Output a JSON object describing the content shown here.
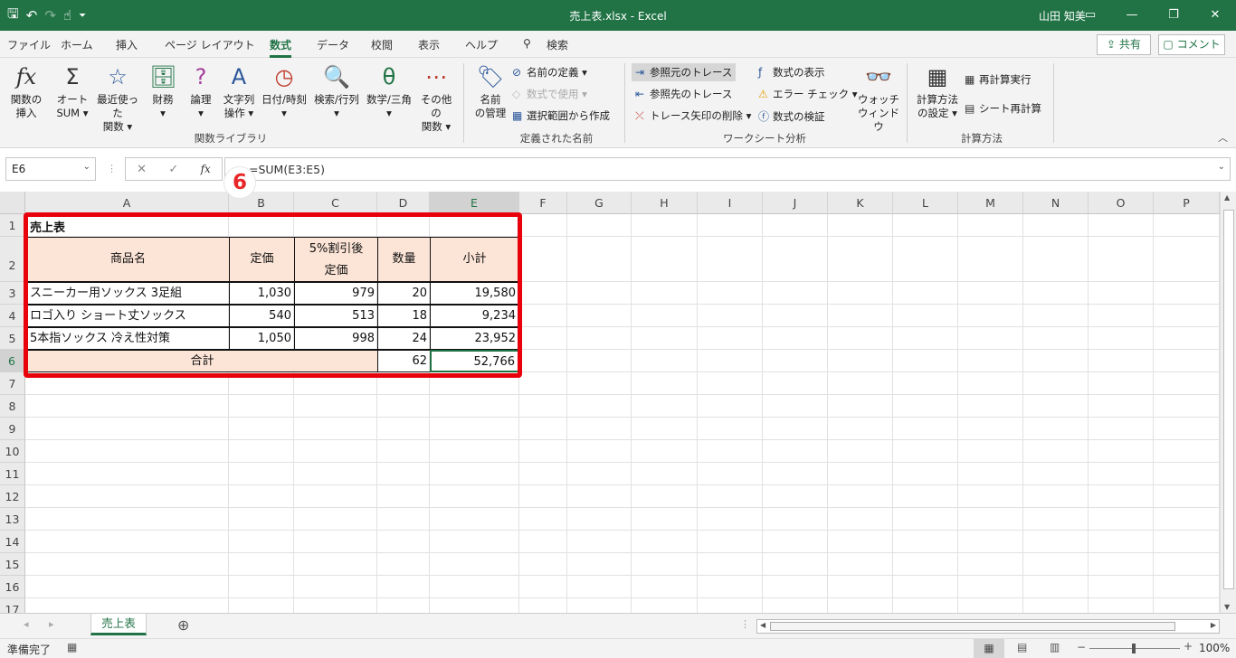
{
  "titlebar": {
    "title": "売上表.xlsx  -  Excel",
    "user": "山田 知美",
    "save_icon": "🖫",
    "undo_icon": "↶",
    "redo_icon": "↷",
    "touch_icon": "☝",
    "qat_menu_icon": "⏷",
    "ribbon_display_icon": "▭",
    "minimize_icon": "—",
    "restore_icon": "❐",
    "close_icon": "✕"
  },
  "tabs": [
    "ファイル",
    "ホーム",
    "挿入",
    "ページ レイアウト",
    "数式",
    "データ",
    "校閲",
    "表示",
    "ヘルプ",
    "検索"
  ],
  "search_icon": "⚲",
  "share_label": "共有",
  "comment_label": "コメント",
  "ribbon": {
    "insert_function": {
      "line1": "関数の",
      "line2": "挿入",
      "icon": "fx"
    },
    "autosum": {
      "line1": "オート",
      "line2": "SUM ▾",
      "icon": "Σ"
    },
    "recent": {
      "line1": "最近使った",
      "line2": "関数 ▾",
      "icon": "☆"
    },
    "financial": {
      "line1": "財務",
      "line2": "▾",
      "icon": "🗄"
    },
    "logical": {
      "line1": "論理",
      "line2": "▾",
      "icon": "?"
    },
    "text": {
      "line1": "文字列",
      "line2": "操作 ▾",
      "icon": "A"
    },
    "datetime": {
      "line1": "日付/時刻",
      "line2": "▾",
      "icon": "◷"
    },
    "lookup": {
      "line1": "検索/行列",
      "line2": "▾",
      "icon": "🔍"
    },
    "math": {
      "line1": "数学/三角",
      "line2": "▾",
      "icon": "θ"
    },
    "more": {
      "line1": "その他の",
      "line2": "関数 ▾",
      "icon": "⋯"
    },
    "group_library": "関数ライブラリ",
    "name_manager": {
      "line1": "名前",
      "line2": "の管理",
      "icon": "🏷"
    },
    "define_name": "名前の定義",
    "use_in_formula": "数式で使用",
    "create_from_selection": "選択範囲から作成",
    "group_names": "定義された名前",
    "trace_precedents": "参照元のトレース",
    "trace_dependents": "参照先のトレース",
    "remove_arrows": "トレース矢印の削除",
    "show_formulas": "数式の表示",
    "error_checking": "エラー チェック",
    "evaluate_formula": "数式の検証",
    "watch_window": {
      "line1": "ウォッチ",
      "line2": "ウィンドウ",
      "icon": "👓"
    },
    "group_audit": "ワークシート分析",
    "calc_options": {
      "line1": "計算方法",
      "line2": "の設定 ▾",
      "icon": "▦"
    },
    "calc_now": "再計算実行",
    "calc_sheet": "シート再計算",
    "group_calc": "計算方法",
    "collapse_icon": "︿"
  },
  "formula_bar": {
    "name_box": "E6",
    "formula": "=SUM(E3:E5)",
    "cancel_icon": "✕",
    "enter_icon": "✓",
    "fx_icon": "fx",
    "dots_icon": "⋮",
    "dropdown_icon": "⌄"
  },
  "marker": "6",
  "columns": [
    "A",
    "B",
    "C",
    "D",
    "E",
    "F",
    "G",
    "H",
    "I",
    "J",
    "K",
    "L",
    "M",
    "N",
    "O",
    "P"
  ],
  "rows": [
    "1",
    "2",
    "3",
    "4",
    "5",
    "6",
    "7",
    "8",
    "9",
    "10",
    "11",
    "12",
    "13",
    "14",
    "15",
    "16",
    "17"
  ],
  "sheet": {
    "title": "売上表",
    "headers": {
      "name": "商品名",
      "price": "定価",
      "discount_line1": "5%割引後",
      "discount_line2": "定価",
      "qty": "数量",
      "subtotal": "小計"
    },
    "items": [
      {
        "name": "スニーカー用ソックス 3足組",
        "price": "1,030",
        "discount": "979",
        "qty": "20",
        "subtotal": "19,580"
      },
      {
        "name": "ロゴ入り ショート丈ソックス",
        "price": "540",
        "discount": "513",
        "qty": "18",
        "subtotal": "9,234"
      },
      {
        "name": "5本指ソックス 冷え性対策",
        "price": "1,050",
        "discount": "998",
        "qty": "24",
        "subtotal": "23,952"
      }
    ],
    "total_label": "合計",
    "total_qty": "62",
    "total_subtotal": "52,766"
  },
  "sheet_tabs": {
    "active": "売上表",
    "add_icon": "⊕",
    "prev_icon": "◂",
    "next_icon": "▸"
  },
  "status": {
    "ready": "準備完了",
    "macro_icon": "▦",
    "zoom": "100%",
    "normal_view_icon": "▦",
    "page_layout_icon": "▤",
    "page_break_icon": "▥",
    "zoom_out_icon": "−",
    "zoom_in_icon": "+"
  },
  "colors": {
    "accent": "#217346",
    "highlight": "#e8000b",
    "header_fill": "#fce4d6"
  }
}
